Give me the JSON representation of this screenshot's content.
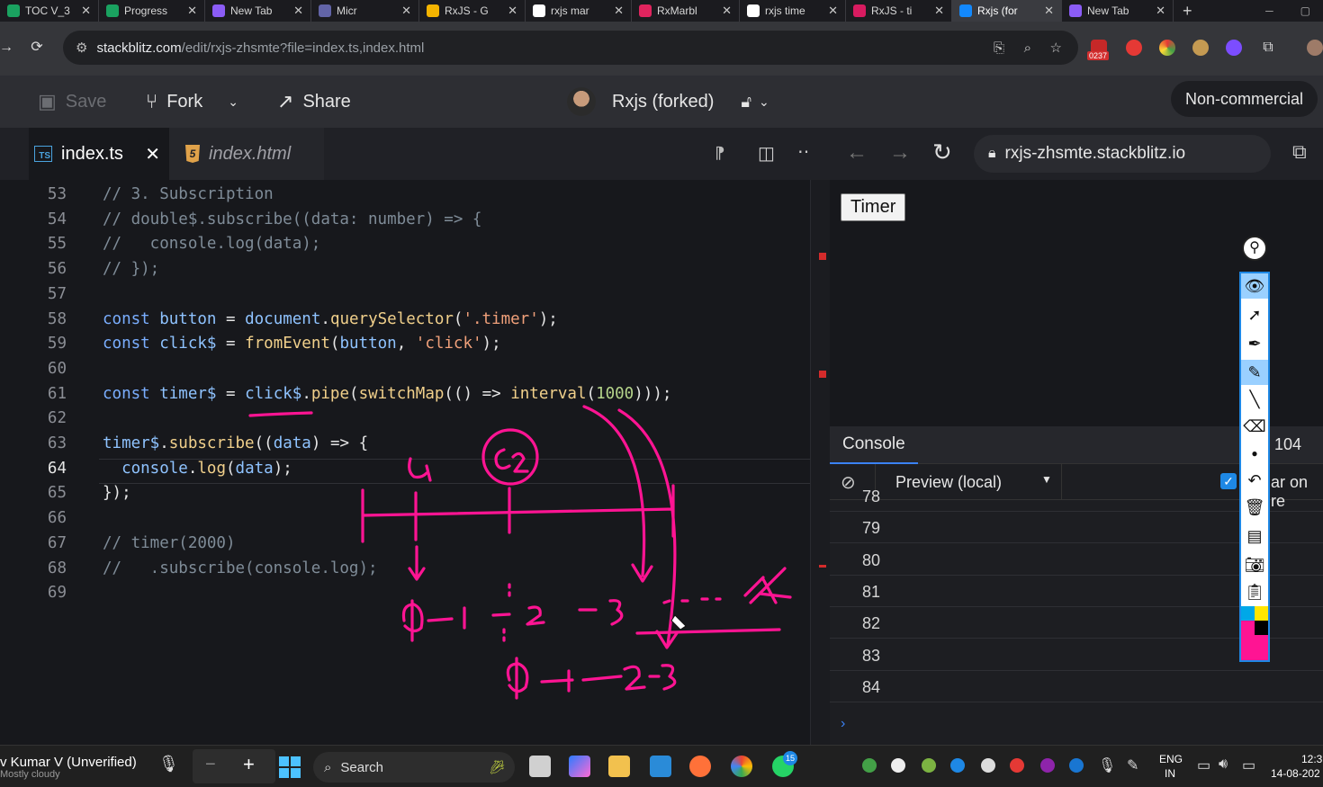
{
  "browser_tabs": [
    {
      "title": "TOC V_3",
      "icon": "sheets-icon",
      "color": "#1aa260"
    },
    {
      "title": "Progress",
      "icon": "sheets-icon",
      "color": "#1aa260"
    },
    {
      "title": "New Tab",
      "icon": "stackblitz-icon",
      "color": "#8b5cf6"
    },
    {
      "title": "Micr",
      "icon": "teams-icon",
      "color": "#6264a7"
    },
    {
      "title": "RxJS - G",
      "icon": "slides-icon",
      "color": "#f4b400"
    },
    {
      "title": "rxjs mar",
      "icon": "google-icon",
      "color": "#ffffff"
    },
    {
      "title": "RxMarbl",
      "icon": "rxmarbles-icon",
      "color": "#e0245e"
    },
    {
      "title": "rxjs time",
      "icon": "google-icon",
      "color": "#ffffff"
    },
    {
      "title": "RxJS - ti",
      "icon": "rxjs-icon",
      "color": "#d81b60"
    },
    {
      "title": "Rxjs (for",
      "icon": "stackblitz-icon",
      "color": "#1389fd",
      "active": true
    },
    {
      "title": "New Tab",
      "icon": "stackblitz-icon",
      "color": "#8b5cf6"
    }
  ],
  "address": {
    "host": "stackblitz.com",
    "path": "/edit/rxjs-zhsmte?file=index.ts,index.html"
  },
  "ext_badge": "0237",
  "header": {
    "save": "Save",
    "fork": "Fork",
    "share": "Share",
    "project": "Rxjs (forked)",
    "noncommercial": "Non-commercial"
  },
  "editor_tabs": [
    {
      "label": "index.ts",
      "active": true
    },
    {
      "label": "index.html",
      "active": false
    }
  ],
  "preview": {
    "url": "rxjs-zhsmte.stackblitz.io",
    "timer_button": "Timer"
  },
  "code_lines": [
    {
      "n": "53",
      "text": "// 3. Subscription"
    },
    {
      "n": "54",
      "text": "// double$.subscribe((data: number) => {"
    },
    {
      "n": "55",
      "text": "//   console.log(data);"
    },
    {
      "n": "56",
      "text": "// });"
    },
    {
      "n": "57",
      "text": ""
    },
    {
      "n": "58",
      "text": "const button = document.querySelector('.timer');"
    },
    {
      "n": "59",
      "text": "const click$ = fromEvent(button, 'click');"
    },
    {
      "n": "60",
      "text": ""
    },
    {
      "n": "61",
      "text": "const timer$ = click$.pipe(switchMap(() => interval(1000)));"
    },
    {
      "n": "62",
      "text": ""
    },
    {
      "n": "63",
      "text": "timer$.subscribe((data) => {"
    },
    {
      "n": "64",
      "text": "  console.log(data);"
    },
    {
      "n": "65",
      "text": "});"
    },
    {
      "n": "66",
      "text": ""
    },
    {
      "n": "67",
      "text": "// timer(2000)"
    },
    {
      "n": "68",
      "text": "//   .subscribe(console.log);"
    },
    {
      "n": "69",
      "text": ""
    }
  ],
  "console": {
    "tab": "Console",
    "count": "104",
    "filter": "Preview (local)",
    "clear_on_reload": "ar on re",
    "rows": [
      "78",
      "79",
      "80",
      "81",
      "82",
      "83",
      "84"
    ]
  },
  "taskbar": {
    "user": "v Kumar V (Unverified)",
    "weather": "Mostly cloudy",
    "search": "Search",
    "whatsapp_badge": "15",
    "lang_top": "ENG",
    "lang_bottom": "IN",
    "time": "12:3",
    "date": "14-08-202"
  }
}
